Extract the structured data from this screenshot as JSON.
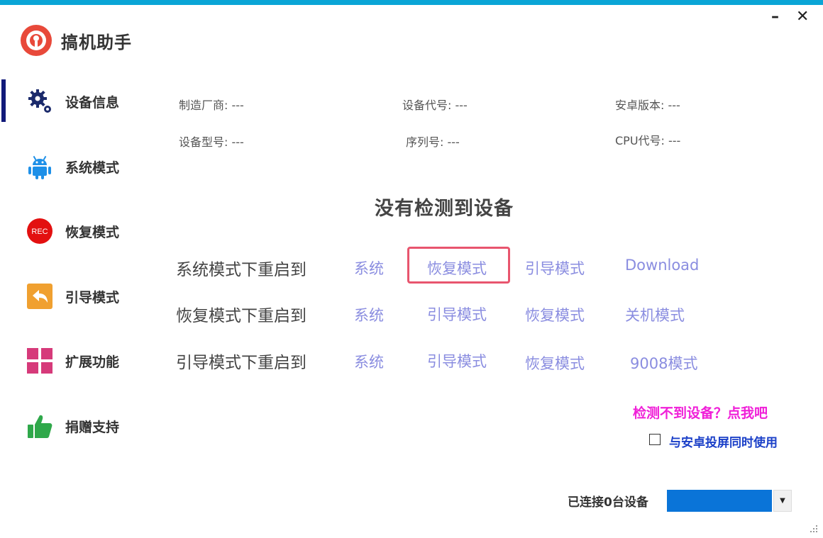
{
  "app": {
    "title": "搞机助手"
  },
  "window": {
    "minimize": "–",
    "close": "✕"
  },
  "nav": [
    {
      "label": "设备信息",
      "icon": "gear-icon",
      "active": true
    },
    {
      "label": "系统模式",
      "icon": "android-icon"
    },
    {
      "label": "恢复模式",
      "icon": "rec-icon",
      "icon_text": "REC"
    },
    {
      "label": "引导模式",
      "icon": "back-arrow-icon"
    },
    {
      "label": "扩展功能",
      "icon": "grid-icon"
    },
    {
      "label": "捐赠支持",
      "icon": "thumbs-up-icon"
    }
  ],
  "device_info": {
    "manufacturer": "制造厂商: ---",
    "device_code": "设备代号: ---",
    "android_version": "安卓版本: ---",
    "model": "设备型号: ---",
    "serial": "序列号: ---",
    "cpu": "CPU代号: ---"
  },
  "no_device": "没有检测到设备",
  "reboot_rows": [
    {
      "label": "系统模式下重启到",
      "options": [
        "系统",
        "恢复模式",
        "引导模式",
        "Download"
      ]
    },
    {
      "label": "恢复模式下重启到",
      "options": [
        "系统",
        "引导模式",
        "恢复模式",
        "关机模式"
      ]
    },
    {
      "label": "引导模式下重启到",
      "options": [
        "系统",
        "引导模式",
        "恢复模式",
        "9008模式"
      ]
    }
  ],
  "help_link": "检测不到设备？点我吧",
  "screen_mirror": {
    "label": "与安卓投屏同时使用",
    "checked": false
  },
  "status": {
    "text": "已连接0台设备"
  },
  "colors": {
    "accent_bar": "#0aa5d6",
    "link": "#8a8de0",
    "highlight": "#e8556e",
    "help": "#f01fd8",
    "checkbox_label": "#1a3fc8",
    "dropdown": "#0a74d8"
  }
}
